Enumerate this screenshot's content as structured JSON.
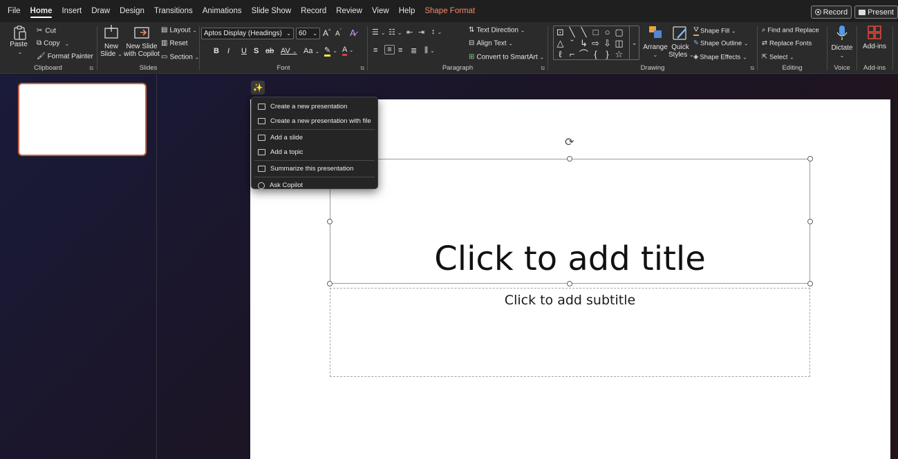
{
  "tabs": [
    "File",
    "Home",
    "Insert",
    "Draw",
    "Design",
    "Transitions",
    "Animations",
    "Slide Show",
    "Record",
    "Review",
    "View",
    "Help",
    "Shape Format"
  ],
  "active_tab": "Home",
  "top_buttons": {
    "record": "Record",
    "present": "Present"
  },
  "clipboard": {
    "paste": "Paste",
    "cut": "Cut",
    "copy": "Copy",
    "format_painter": "Format Painter",
    "label": "Clipboard"
  },
  "slides": {
    "new_slide_1": "New",
    "new_slide_2": "Slide",
    "copilot_1": "New Slide",
    "copilot_2": "with Copilot",
    "layout": "Layout",
    "reset": "Reset",
    "section": "Section",
    "label": "Slides"
  },
  "font": {
    "family": "Aptos Display (Headings)",
    "size": "60",
    "label": "Font",
    "bold": "B",
    "italic": "I",
    "underline": "U",
    "shadow": "S",
    "strike": "ab",
    "spacing": "AV",
    "case": "Aa",
    "grow": "A",
    "shrink": "A"
  },
  "paragraph": {
    "text_direction": "Text Direction",
    "align_text": "Align Text",
    "convert_smartart": "Convert to SmartArt",
    "label": "Paragraph"
  },
  "drawing": {
    "arrange": "Arrange",
    "quick_styles_1": "Quick",
    "quick_styles_2": "Styles",
    "shape_fill": "Shape Fill",
    "shape_outline": "Shape Outline",
    "shape_effects": "Shape Effects",
    "label": "Drawing"
  },
  "editing": {
    "find_replace": "Find and Replace",
    "replace_fonts": "Replace Fonts",
    "select": "Select",
    "label": "Editing"
  },
  "voice": {
    "dictate": "Dictate",
    "label": "Voice"
  },
  "addins": {
    "addins": "Add-ins",
    "label": "Add-ins"
  },
  "copilot_menu": {
    "items": [
      "Create a new presentation",
      "Create a new presentation with file",
      "Add a slide",
      "Add a topic",
      "Summarize this presentation",
      "Ask Copilot"
    ]
  },
  "slide": {
    "title_placeholder": "Click to add title",
    "subtitle_placeholder": "Click to add subtitle"
  },
  "colors": {
    "accent": "#c8644b",
    "context_tab": "#f08a6b",
    "ribbon": "#2b2b2b",
    "tabbar": "#1f1f1f"
  }
}
